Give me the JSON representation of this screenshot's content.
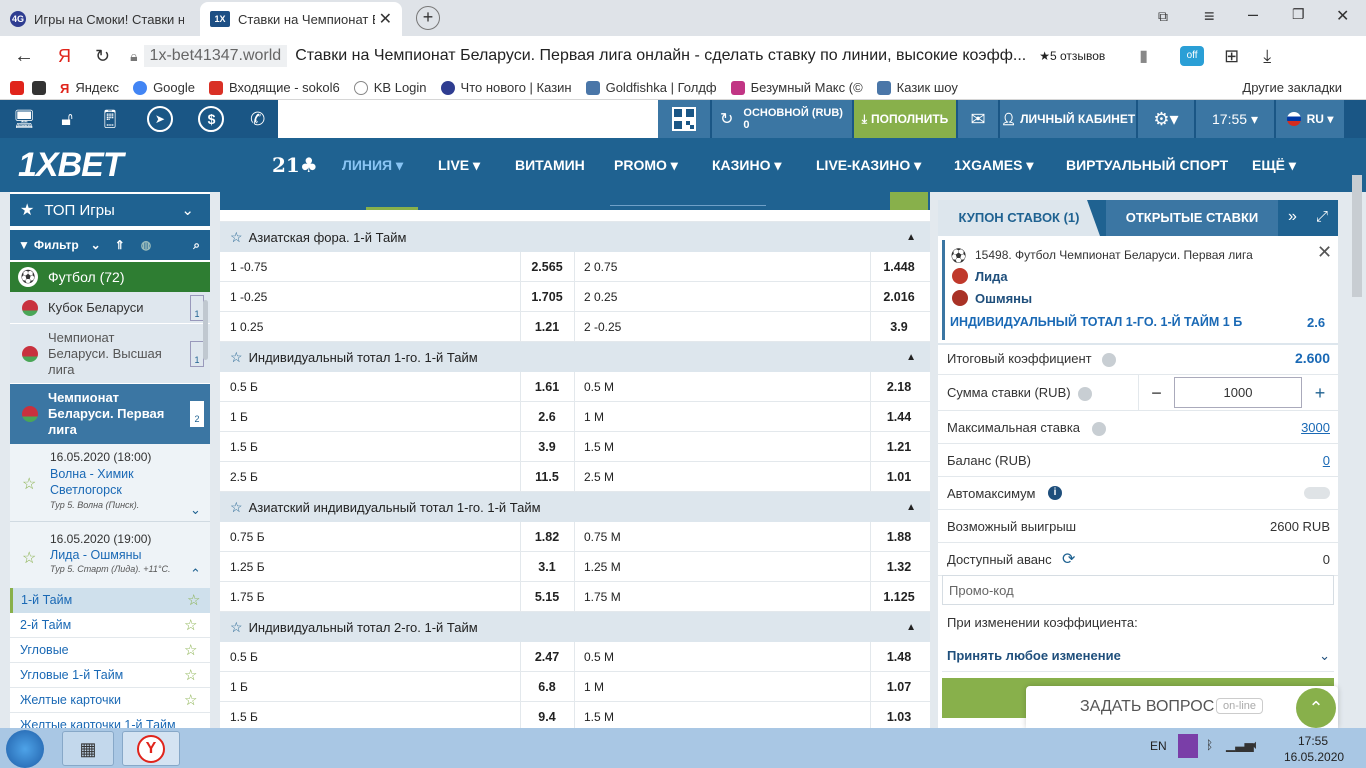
{
  "browser": {
    "tabs": [
      {
        "title": "Игры на Смоки! Ставки на",
        "active": false
      },
      {
        "title": "Ставки на Чемпионат Б",
        "active": true
      }
    ],
    "url_domain": "1x-bet41347.world",
    "page_title": "Ставки на Чемпионат Беларуси. Первая лига онлайн - сделать ставку по линии, высокие коэфф...",
    "reviews": "★5 отзывов",
    "ext_badge": "off",
    "bookmarks": [
      "Яндекс",
      "Google",
      "Входящие - sokol6",
      "KB Login",
      "Что нового | Казин",
      "Goldfishka | Голдф",
      "Безумный Макс (©",
      "Казик шоу"
    ],
    "other_bookmarks": "Другие закладки"
  },
  "site": {
    "balance_label": "ОСНОВНОЙ (RUB)",
    "balance_value": "0",
    "deposit": "ПОПОЛНИТЬ",
    "cabinet": "ЛИЧНЫЙ КАБИНЕТ",
    "time": "17:55",
    "lang": "RU",
    "logo": "1XBET",
    "nav": [
      "ЛИНИЯ",
      "LIVE",
      "ВИТАМИН",
      "PROMO",
      "КАЗИНО",
      "LIVE-КАЗИНО",
      "1XGAMES",
      "ВИРТУАЛЬНЫЙ СПОРТ",
      "ЕЩЁ"
    ],
    "nav_21": "21"
  },
  "left": {
    "top_games": "ТОП Игры",
    "filter": "Фильтр",
    "football": "Футбол (72)",
    "leagues": [
      {
        "name": "Кубок Беларуси",
        "count": "1"
      },
      {
        "name": "Чемпионат Беларуси. Высшая лига",
        "count": "1"
      },
      {
        "name": "Чемпионат Беларуси. Первая лига",
        "count": "2"
      }
    ],
    "matches": [
      {
        "date": "16.05.2020 (18:00)",
        "teams": "Волна - Химик Светлогорск",
        "info": "Тур 5. Волна (Пинск)."
      },
      {
        "date": "16.05.2020 (19:00)",
        "teams": "Лида - Ошмяны",
        "info": "Тур 5. Старт (Лида). +11°C."
      }
    ],
    "markets": [
      "1-й Тайм",
      "2-й Тайм",
      "Угловые",
      "Угловые 1-й Тайм",
      "Желтые карточки",
      "Желтые карточки 1-й Тайм"
    ]
  },
  "center": {
    "sections": [
      {
        "title": "Азиатская фора. 1-й Тайм",
        "rows": [
          [
            "1 -0.75",
            "2.565",
            "2 0.75",
            "1.448"
          ],
          [
            "1 -0.25",
            "1.705",
            "2 0.25",
            "2.016"
          ],
          [
            "1 0.25",
            "1.21",
            "2 -0.25",
            "3.9"
          ]
        ]
      },
      {
        "title": "Индивидуальный тотал 1-го. 1-й Тайм",
        "rows": [
          [
            "0.5 Б",
            "1.61",
            "0.5 М",
            "2.18"
          ],
          [
            "1 Б",
            "2.6",
            "1 М",
            "1.44"
          ],
          [
            "1.5 Б",
            "3.9",
            "1.5 М",
            "1.21"
          ],
          [
            "2.5 Б",
            "11.5",
            "2.5 М",
            "1.01"
          ]
        ]
      },
      {
        "title": "Азиатский индивидуальный тотал 1-го. 1-й Тайм",
        "rows": [
          [
            "0.75 Б",
            "1.82",
            "0.75 М",
            "1.88"
          ],
          [
            "1.25 Б",
            "3.1",
            "1.25 М",
            "1.32"
          ],
          [
            "1.75 Б",
            "5.15",
            "1.75 М",
            "1.125"
          ]
        ]
      },
      {
        "title": "Индивидуальный тотал 2-го. 1-й Тайм",
        "rows": [
          [
            "0.5 Б",
            "2.47",
            "0.5 М",
            "1.48"
          ],
          [
            "1 Б",
            "6.8",
            "1 М",
            "1.07"
          ],
          [
            "1.5 Б",
            "9.4",
            "1.5 М",
            "1.03"
          ]
        ]
      }
    ]
  },
  "coupon": {
    "tab_active": "КУПОН СТАВОК (1)",
    "tab_other": "ОТКРЫТЫЕ СТАВКИ",
    "event": "15498. Футбол Чемпионат Беларуси. Первая лига",
    "team1": "Лида",
    "team2": "Ошмяны",
    "pick": "ИНДИВИДУАЛЬНЫЙ ТОТАЛ 1-ГО. 1-Й ТАЙМ 1 Б",
    "pick_odd": "2.6",
    "total_label": "Итоговый коэффициент",
    "total_value": "2.600",
    "stake_label": "Сумма ставки (RUB)",
    "stake_value": "1000",
    "max_label": "Максимальная ставка",
    "max_value": "3000",
    "balance_label": "Баланс (RUB)",
    "balance_value": "0",
    "auto_label": "Автомаксимум",
    "win_label": "Возможный выигрыш",
    "win_value": "2600 RUB",
    "advance_label": "Доступный аванс",
    "advance_value": "0",
    "promo_placeholder": "Промо-код",
    "change_label": "При изменении коэффициента:",
    "change_value": "Принять любое изменение",
    "ask": "ЗАДАТЬ ВОПРОС",
    "online": "on-line"
  },
  "taskbar": {
    "lang": "EN",
    "time": "17:55",
    "date": "16.05.2020"
  },
  "colors": {
    "primary": "#1f6291",
    "accent": "#88b04b",
    "link": "#1a69b5"
  }
}
